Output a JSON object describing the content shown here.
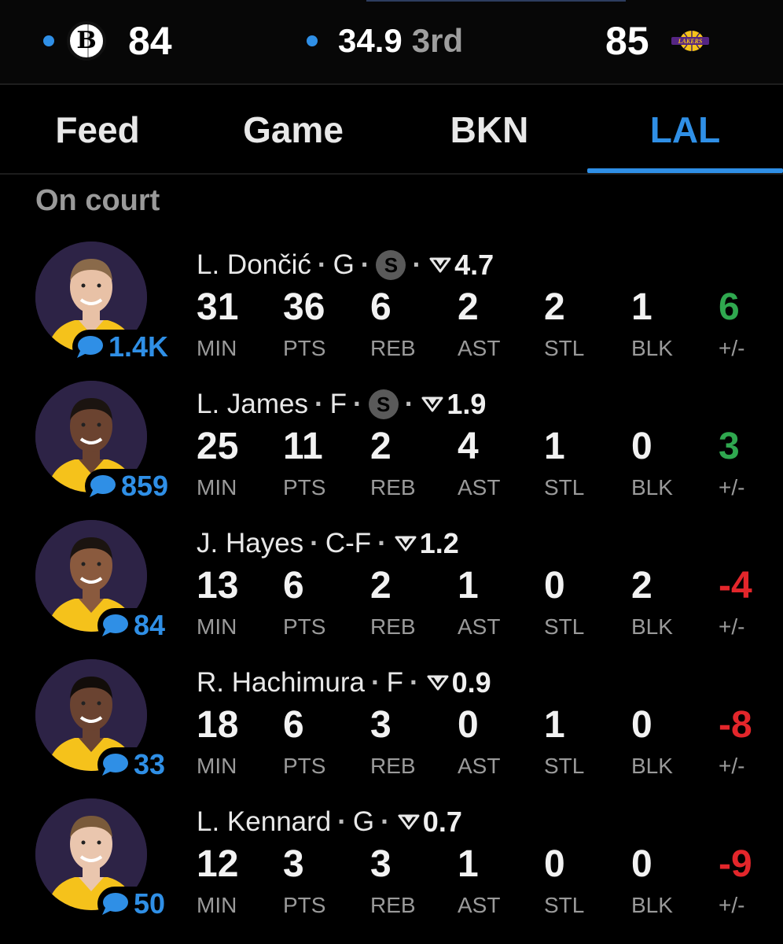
{
  "scoreboard": {
    "home_score": "84",
    "home_logo_letter": "B",
    "game_clock": "34.9",
    "period": "3rd",
    "away_score": "85",
    "away_logo_text": "LAKERS"
  },
  "tabs": [
    "Feed",
    "Game",
    "BKN",
    "LAL"
  ],
  "active_tab": "LAL",
  "section_title": "On court",
  "stat_labels": [
    "MIN",
    "PTS",
    "REB",
    "AST",
    "STL",
    "BLK",
    "+/-"
  ],
  "starter_badge": "S",
  "colors": {
    "accent": "#2f8fe6",
    "positive": "#2fa84f",
    "negative": "#e3262b",
    "avatar_bg": "#2d2346",
    "jersey": "#f5c21b"
  },
  "players": [
    {
      "name": "L. Dončić",
      "position": "G",
      "starter": true,
      "rating": "4.7",
      "comments": "1.4K",
      "skin": "#e8c1a6",
      "hair": "#8a6a4a",
      "stats": [
        "31",
        "36",
        "6",
        "2",
        "2",
        "1",
        "6"
      ],
      "plusminus_sign": "positive"
    },
    {
      "name": "L. James",
      "position": "F",
      "starter": true,
      "rating": "1.9",
      "comments": "859",
      "skin": "#6b4330",
      "hair": "#1b1410",
      "stats": [
        "25",
        "11",
        "2",
        "4",
        "1",
        "0",
        "3"
      ],
      "plusminus_sign": "positive"
    },
    {
      "name": "J. Hayes",
      "position": "C-F",
      "starter": false,
      "rating": "1.2",
      "comments": "84",
      "skin": "#8a5a3e",
      "hair": "#1b1410",
      "stats": [
        "13",
        "6",
        "2",
        "1",
        "0",
        "2",
        "-4"
      ],
      "plusminus_sign": "negative"
    },
    {
      "name": "R. Hachimura",
      "position": "F",
      "starter": false,
      "rating": "0.9",
      "comments": "33",
      "skin": "#6a4331",
      "hair": "#120d0a",
      "stats": [
        "18",
        "6",
        "3",
        "0",
        "1",
        "0",
        "-8"
      ],
      "plusminus_sign": "negative"
    },
    {
      "name": "L. Kennard",
      "position": "G",
      "starter": false,
      "rating": "0.7",
      "comments": "50",
      "skin": "#eac6ae",
      "hair": "#7a5a3a",
      "stats": [
        "12",
        "3",
        "3",
        "1",
        "0",
        "0",
        "-9"
      ],
      "plusminus_sign": "negative"
    }
  ]
}
